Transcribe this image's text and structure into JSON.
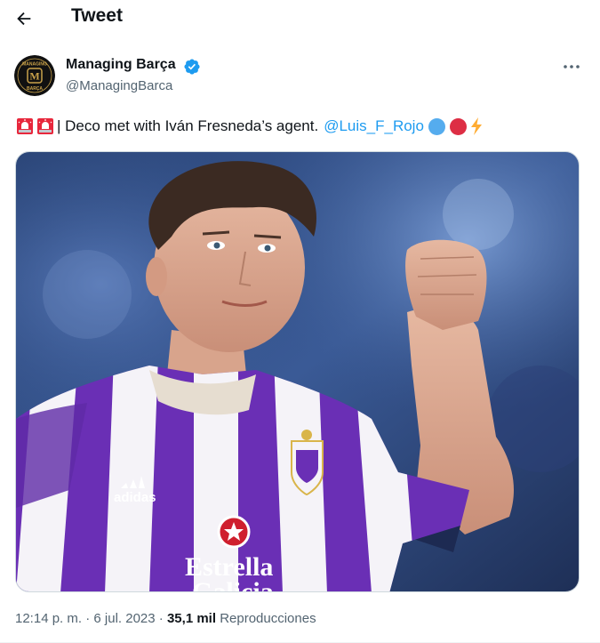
{
  "header": {
    "title": "Tweet"
  },
  "author": {
    "name": "Managing Barça",
    "handle": "@ManagingBarca",
    "avatar_text_top": "MANAGING",
    "avatar_text_bottom": "BARÇA",
    "avatar_letter": "M"
  },
  "tweet": {
    "text": "| Deco met with Iván Fresneda’s agent.",
    "mention": "@Luis_F_Rojo",
    "media_jersey_brand": "adidas",
    "media_sponsor_line1": "Estrella",
    "media_sponsor_line2": "Galicia"
  },
  "meta": {
    "time": "12:14 p. m.",
    "separator": " · ",
    "date": "6 jul. 2023",
    "views_count": "35,1 mil",
    "views_label": "Reproducciones"
  },
  "colors": {
    "accent": "#1d9bf0",
    "text": "#0f1419",
    "muted": "#536471",
    "jersey_purple": "#6a2fb5"
  },
  "icons": [
    "back-arrow-icon",
    "verified-badge-icon",
    "more-icon",
    "siren-icon",
    "blue-circle-icon",
    "red-circle-icon",
    "lightning-icon"
  ]
}
